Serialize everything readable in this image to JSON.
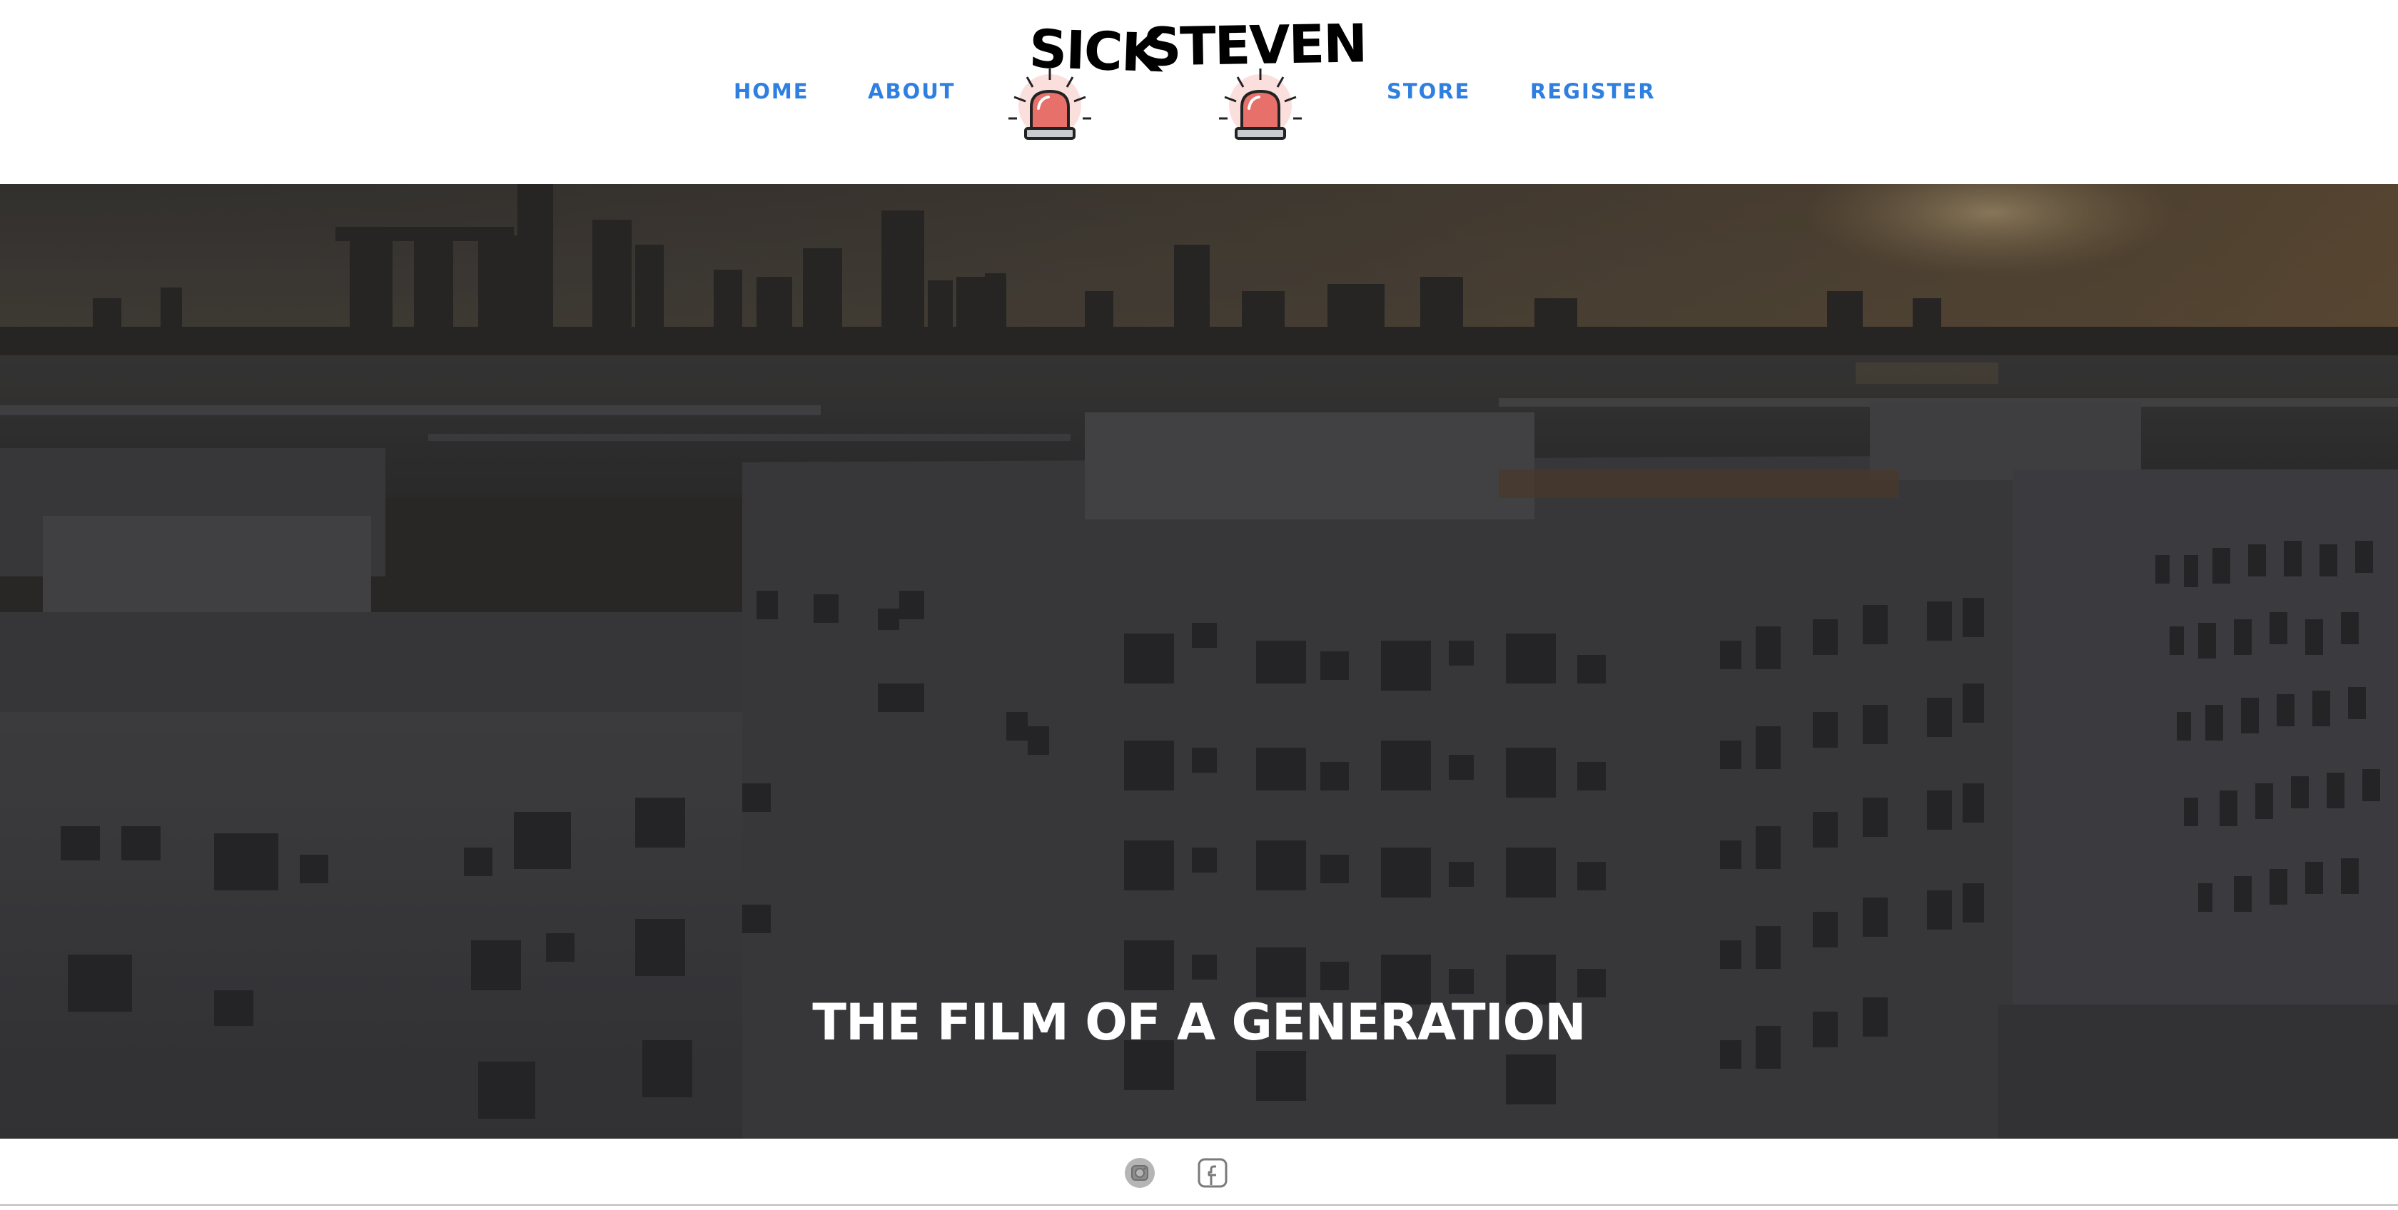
{
  "nav": {
    "home": "HOME",
    "about": "ABOUT",
    "store": "STORE",
    "register": "REGISTER"
  },
  "logo": {
    "word1": "SICK",
    "word2": "STEVEN"
  },
  "hero": {
    "title": "THE FILM OF A GENERATION"
  },
  "footer": {
    "instagram_icon": "instagram-icon",
    "facebook_icon": "facebook-icon"
  },
  "colors": {
    "nav_link": "#2f7fe0",
    "siren_red": "#e8706a",
    "siren_glow": "#f6c9c6"
  }
}
